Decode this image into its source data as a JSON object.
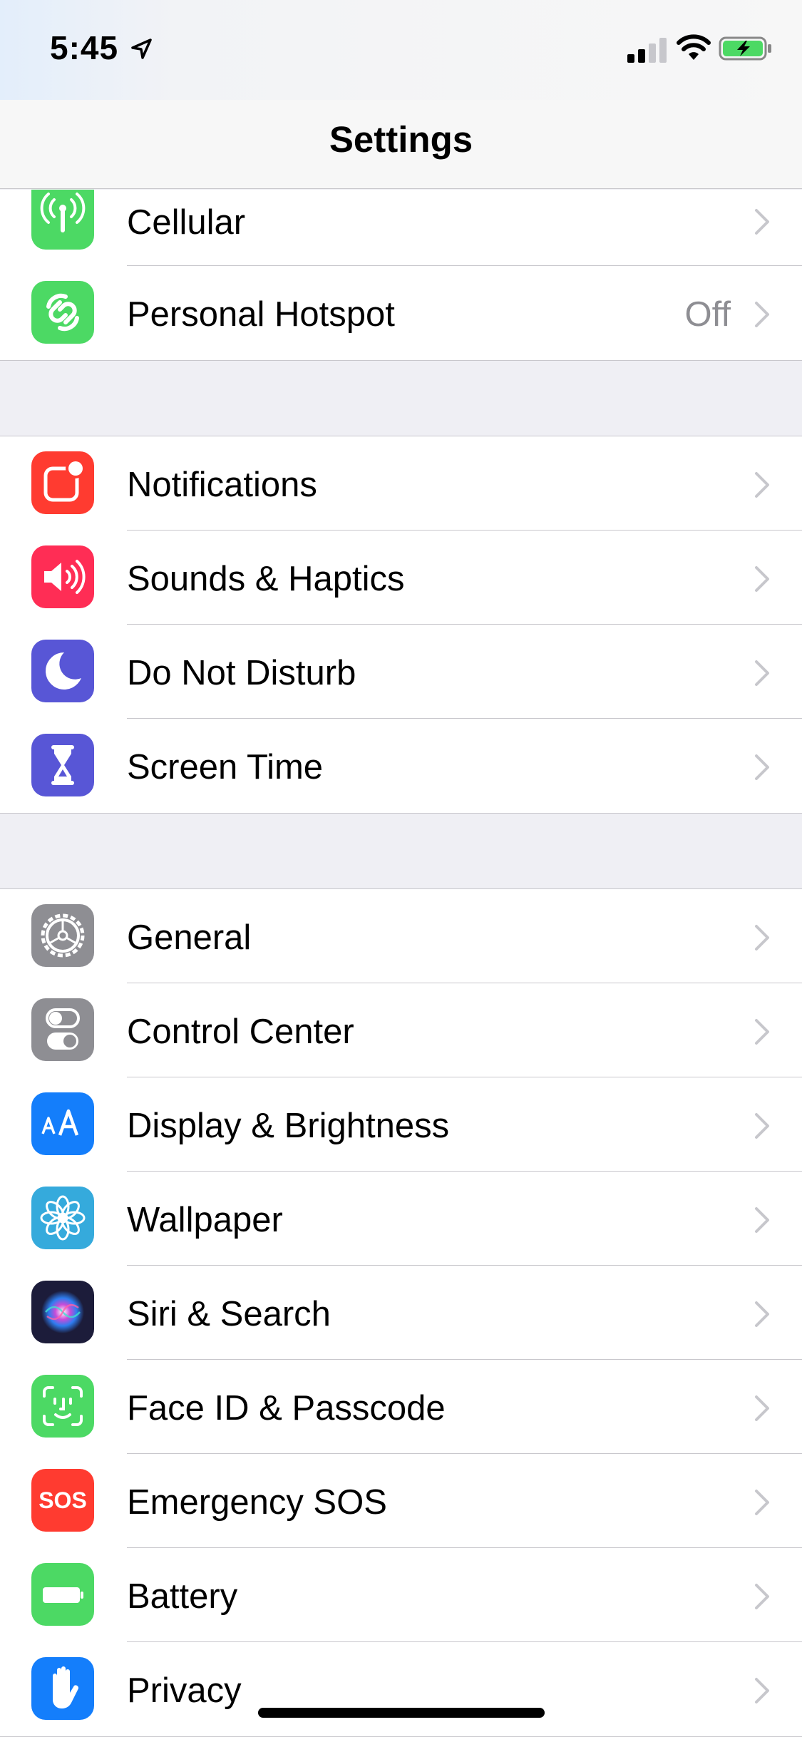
{
  "status": {
    "time": "5:45"
  },
  "nav": {
    "title": "Settings"
  },
  "groups": [
    {
      "items": [
        {
          "label": "Cellular",
          "icon": "cellular-icon",
          "color": "#4cd964"
        },
        {
          "label": "Personal Hotspot",
          "value": "Off",
          "icon": "hotspot-icon",
          "color": "#4cd964"
        }
      ]
    },
    {
      "items": [
        {
          "label": "Notifications",
          "icon": "notifications-icon",
          "color": "#ff3b30"
        },
        {
          "label": "Sounds & Haptics",
          "icon": "speaker-icon",
          "color": "#ff2d55"
        },
        {
          "label": "Do Not Disturb",
          "icon": "moon-icon",
          "color": "#5856d6"
        },
        {
          "label": "Screen Time",
          "icon": "hourglass-icon",
          "color": "#5856d6"
        }
      ]
    },
    {
      "items": [
        {
          "label": "General",
          "icon": "gear-icon",
          "color": "#8e8e93"
        },
        {
          "label": "Control Center",
          "icon": "toggles-icon",
          "color": "#8e8e93"
        },
        {
          "label": "Display & Brightness",
          "icon": "text-size-icon",
          "color": "#147efb"
        },
        {
          "label": "Wallpaper",
          "icon": "flower-icon",
          "color": "#35aadc"
        },
        {
          "label": "Siri & Search",
          "icon": "siri-icon",
          "color": "#1c1c3a"
        },
        {
          "label": "Face ID & Passcode",
          "icon": "face-id-icon",
          "color": "#4cd964"
        },
        {
          "label": "Emergency SOS",
          "icon": "sos-icon",
          "color": "#ff3b30",
          "icon_text": "SOS"
        },
        {
          "label": "Battery",
          "icon": "battery-setting-icon",
          "color": "#4cd964"
        },
        {
          "label": "Privacy",
          "icon": "hand-icon",
          "color": "#147efb"
        }
      ]
    }
  ]
}
